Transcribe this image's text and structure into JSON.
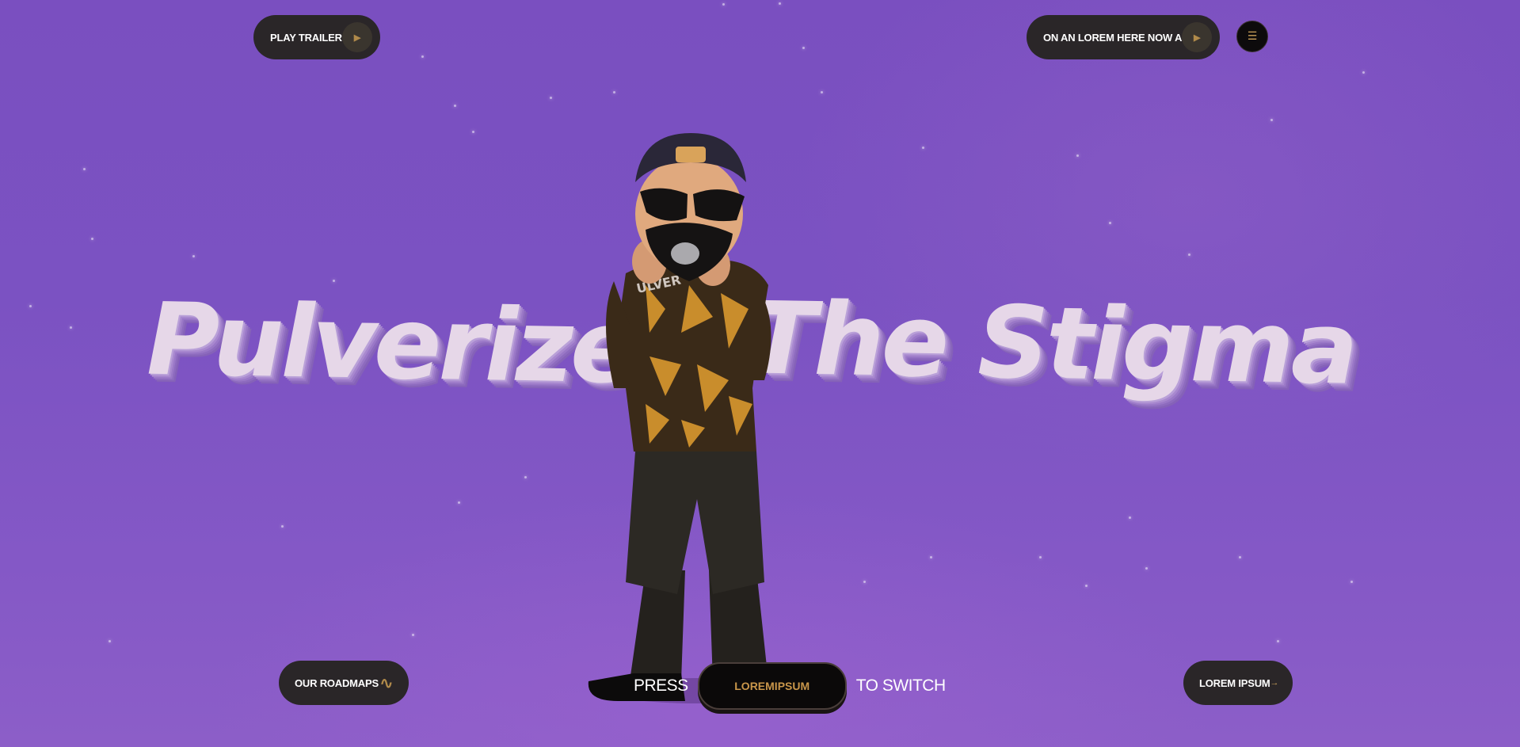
{
  "header": {
    "play_trailer_label": "PLAY TRAILER",
    "cta_label": "ON AN LOREM HERE NOW A",
    "play_icon": "play-icon",
    "menu_icon": "menu-icon"
  },
  "hero": {
    "title_part1": "Pulverize",
    "title_dash": "-",
    "title_part2": "The Stigma"
  },
  "footer": {
    "roadmaps_label": "OUR ROADMAPS",
    "roadmaps_icon": "route-icon",
    "press_label": "PRESS",
    "key_label": "LOREMIPSUM",
    "switch_label": "TO SWITCH",
    "lorem_ipsum_label": "LOREM IPSUM",
    "arrow_icon": "arrow-right-icon"
  },
  "colors": {
    "background": "#7b52c2",
    "pill": "#2a2628",
    "accent": "#c9964a",
    "title": "#e6d7e8"
  }
}
